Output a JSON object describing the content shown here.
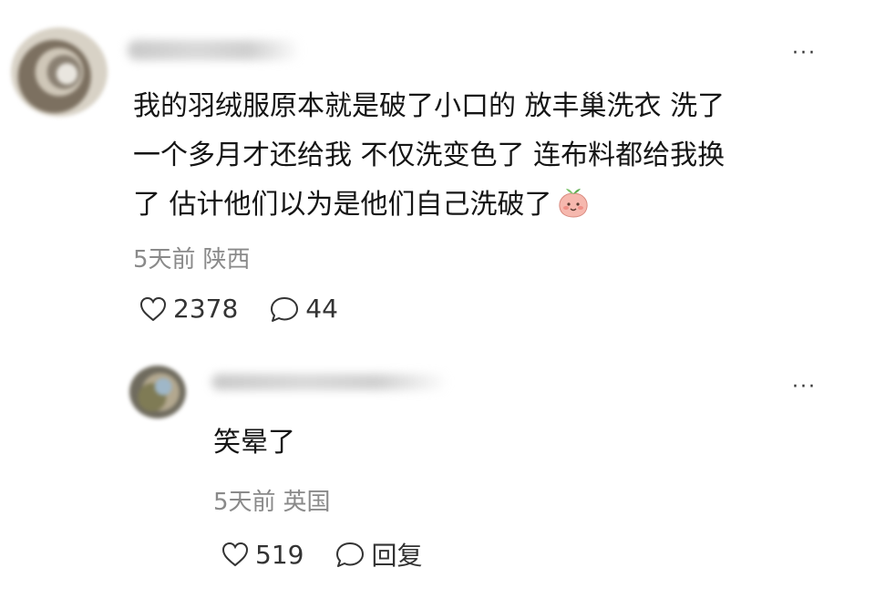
{
  "main_comment": {
    "text_line1": "我的羽绒服原本就是破了小口的 放丰巢洗衣 洗了",
    "text_line2": "一个多月才还给我 不仅洗变色了 连布料都给我换",
    "text_line3": "了 估计他们以为是他们自己洗破了",
    "emoji": "peach-face-emoji",
    "time": "5天前",
    "location": "陕西",
    "likes": "2378",
    "replies": "44",
    "more_label": "···"
  },
  "reply": {
    "text": "笑晕了",
    "time": "5天前",
    "location": "英国",
    "likes": "519",
    "reply_label": "回复",
    "more_label": "···"
  },
  "icons": {
    "like": "heart-outline-icon",
    "comment": "speech-bubble-icon",
    "reply": "speech-bubble-icon"
  }
}
